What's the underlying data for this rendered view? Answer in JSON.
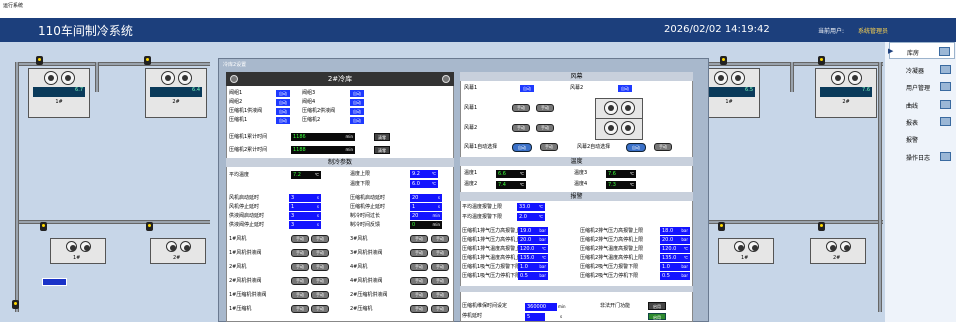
{
  "top_strip": "运行系统",
  "header": {
    "title": "110车间制冷系统",
    "datetime": "2026/02/02  14:19:42",
    "user_label": "当前用户:",
    "user_name": "系统管理员"
  },
  "sidebar": {
    "items": [
      {
        "label": "库房",
        "icon": "monitor-icon"
      },
      {
        "label": "冷凝器",
        "icon": "monitor-icon"
      },
      {
        "label": "用户管理",
        "icon": "monitor-icon"
      },
      {
        "label": "曲线",
        "icon": "chart-icon"
      },
      {
        "label": "报表",
        "icon": "save-icon"
      },
      {
        "label": "报警",
        "icon": ""
      },
      {
        "label": "操作日志",
        "icon": "monitor-icon"
      }
    ]
  },
  "units": {
    "u1": {
      "num": "1#",
      "screen": "6.7"
    },
    "u2": {
      "num": "2#",
      "screen": "6.4"
    },
    "u3": {
      "num": "1#",
      "screen": "6.5"
    },
    "u4": {
      "num": "2#",
      "screen": "7.6"
    },
    "s1": {
      "num": "1#"
    },
    "s2": {
      "num": "2#"
    },
    "s3": {
      "num": "1#"
    },
    "s4": {
      "num": "2#"
    }
  },
  "dialog": {
    "title": "冷库2设置",
    "left": {
      "header": "2#冷库",
      "valves": [
        {
          "label": "阀组1",
          "btn": "自动"
        },
        {
          "label": "阀组3",
          "btn": "自动"
        },
        {
          "label": "阀组2",
          "btn": "自动"
        },
        {
          "label": "阀组4",
          "btn": "自动"
        },
        {
          "label": "压缩机1供液阀",
          "btn": "自动"
        },
        {
          "label": "压缩机2供液阀",
          "btn": "自动"
        },
        {
          "label": "压缩机1",
          "btn": "自动"
        },
        {
          "label": "压缩机2",
          "btn": "自动"
        }
      ],
      "run1_label": "压缩机1累计时间",
      "run1_val": "1186",
      "run1_unit": "min",
      "run2_label": "压缩机2累计时间",
      "run2_val": "1188",
      "run2_unit": "min",
      "reset": "清零",
      "section_params": "制冷参数",
      "avg_temp_label": "平均温度",
      "avg_temp": "7.2",
      "avg_temp_unit": "℃",
      "temp_upper_label": "温度上限",
      "temp_upper": "9.2",
      "temp_upper_unit": "℃",
      "temp_lower_label": "温度下限",
      "temp_lower": "6.0",
      "temp_lower_unit": "℃",
      "delays": [
        {
          "label": "风机启动延时",
          "val": "3",
          "unit": "s"
        },
        {
          "label": "压缩机启动延时",
          "val": "20",
          "unit": "s"
        },
        {
          "label": "风机停止延时",
          "val": "1",
          "unit": "s"
        },
        {
          "label": "压缩机停止延时",
          "val": "1",
          "unit": "s"
        },
        {
          "label": "供液阀启动延时",
          "val": "3",
          "unit": "s"
        },
        {
          "label": "制冷时间过长",
          "val": "20",
          "unit": "min"
        },
        {
          "label": "供液阀停止延时",
          "val": "3",
          "unit": "s"
        },
        {
          "label": "制冷时间反馈",
          "val": "0",
          "unit": "min"
        }
      ],
      "controls": [
        {
          "label": "1#风机",
          "b1": "手动",
          "b2": "手动"
        },
        {
          "label": "3#风机",
          "b1": "手动",
          "b2": "手动"
        },
        {
          "label": "1#风机供液阀",
          "b1": "手动",
          "b2": "手动"
        },
        {
          "label": "3#风机供液阀",
          "b1": "手动",
          "b2": "手动"
        },
        {
          "label": "2#风机",
          "b1": "手动",
          "b2": "手动"
        },
        {
          "label": "4#风机",
          "b1": "手动",
          "b2": "手动"
        },
        {
          "label": "2#风机供液阀",
          "b1": "手动",
          "b2": "手动"
        },
        {
          "label": "4#风机供液阀",
          "b1": "手动",
          "b2": "手动"
        },
        {
          "label": "1#压缩机供液阀",
          "b1": "手动",
          "b2": "手动"
        },
        {
          "label": "2#压缩机供液阀",
          "b1": "手动",
          "b2": "手动"
        },
        {
          "label": "1#压缩机",
          "b1": "手动",
          "b2": "手动"
        },
        {
          "label": "2#压缩机",
          "b1": "手动",
          "b2": "手动"
        }
      ]
    },
    "right": {
      "section_fan": "风幕",
      "fan1_label": "风幕1",
      "fan1_btn": "自动",
      "fan2_label": "风幕2",
      "fan2_btn": "自动",
      "fan_row1": "风幕1",
      "fan_row2": "风幕2",
      "manual": "手动",
      "auto_sel1": "风幕1自动选择",
      "auto_sel2": "风幕2自动选择",
      "auto": "自动",
      "section_temp": "温度",
      "temps": [
        {
          "label": "温度1",
          "val": "6.6",
          "unit": "℃"
        },
        {
          "label": "温度3",
          "val": "7.6",
          "unit": "℃"
        },
        {
          "label": "温度2",
          "val": "7.4",
          "unit": "℃"
        },
        {
          "label": "温度4",
          "val": "7.3",
          "unit": "℃"
        }
      ],
      "section_alarm": "报警",
      "avg_hi_label": "平均温度报警上限",
      "avg_hi": "33.0",
      "avg_hi_unit": "℃",
      "avg_lo_label": "平均温度报警下限",
      "avg_lo": "2.0",
      "avg_lo_unit": "℃",
      "alarms": [
        {
          "label": "压缩机1排气压力高报警上限",
          "val": "19.0",
          "unit": "bar"
        },
        {
          "label": "压缩机2排气压力高报警上限",
          "val": "18.0",
          "unit": "bar"
        },
        {
          "label": "压缩机1排气压力高停机上限",
          "val": "20.0",
          "unit": "bar"
        },
        {
          "label": "压缩机2排气压力高停机上限",
          "val": "20.0",
          "unit": "bar"
        },
        {
          "label": "压缩机1排气温度高报警上限",
          "val": "120.0",
          "unit": "℃"
        },
        {
          "label": "压缩机2排气温度高报警上限",
          "val": "120.0",
          "unit": "℃"
        },
        {
          "label": "压缩机1排气温度高停机上限",
          "val": "135.0",
          "unit": "℃"
        },
        {
          "label": "压缩机2排气温度高停机上限",
          "val": "135.0",
          "unit": "℃"
        },
        {
          "label": "压缩机1吸气压力报警下限",
          "val": "1.0",
          "unit": "bar"
        },
        {
          "label": "压缩机2吸气压力报警下限",
          "val": "1.0",
          "unit": "bar"
        },
        {
          "label": "压缩机1吸气压力停机下限",
          "val": "0.5",
          "unit": "bar"
        },
        {
          "label": "压缩机2吸气压力停机下限",
          "val": "0.5",
          "unit": "bar"
        }
      ],
      "hold_label": "压缩机维保时间设定",
      "hold_val": "360000",
      "hold_unit": "min",
      "reset_label": "停机延时",
      "reset_val": "5",
      "reset_unit": "s",
      "door_label": "非法开门功能",
      "door_btn": "启用",
      "door_btn2": "启用"
    }
  }
}
